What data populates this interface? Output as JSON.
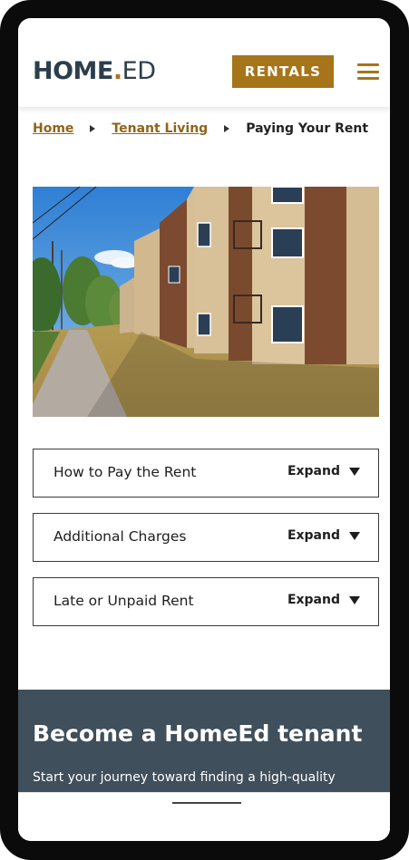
{
  "header": {
    "logo_home": "HOME",
    "logo_dot": ".",
    "logo_ed": "ED",
    "rentals_label": "RENTALS",
    "menu_icon": "hamburger-icon"
  },
  "breadcrumb": {
    "items": [
      "Home",
      "Tenant Living"
    ],
    "current": "Paying Your Rent"
  },
  "hero": {
    "alt": "Brown and beige apartment building with lawn and sidewalk"
  },
  "accordions": [
    {
      "title": "How to Pay the Rent",
      "action": "Expand"
    },
    {
      "title": "Additional Charges",
      "action": "Expand"
    },
    {
      "title": "Late or Unpaid Rent",
      "action": "Expand"
    }
  ],
  "cta": {
    "heading": "Become a HomeEd tenant",
    "text": "Start your journey toward finding a high-quality"
  },
  "colors": {
    "brand_gold": "#a67419",
    "brand_navy": "#2c3e4c",
    "cta_bg": "#3f4f5b"
  }
}
